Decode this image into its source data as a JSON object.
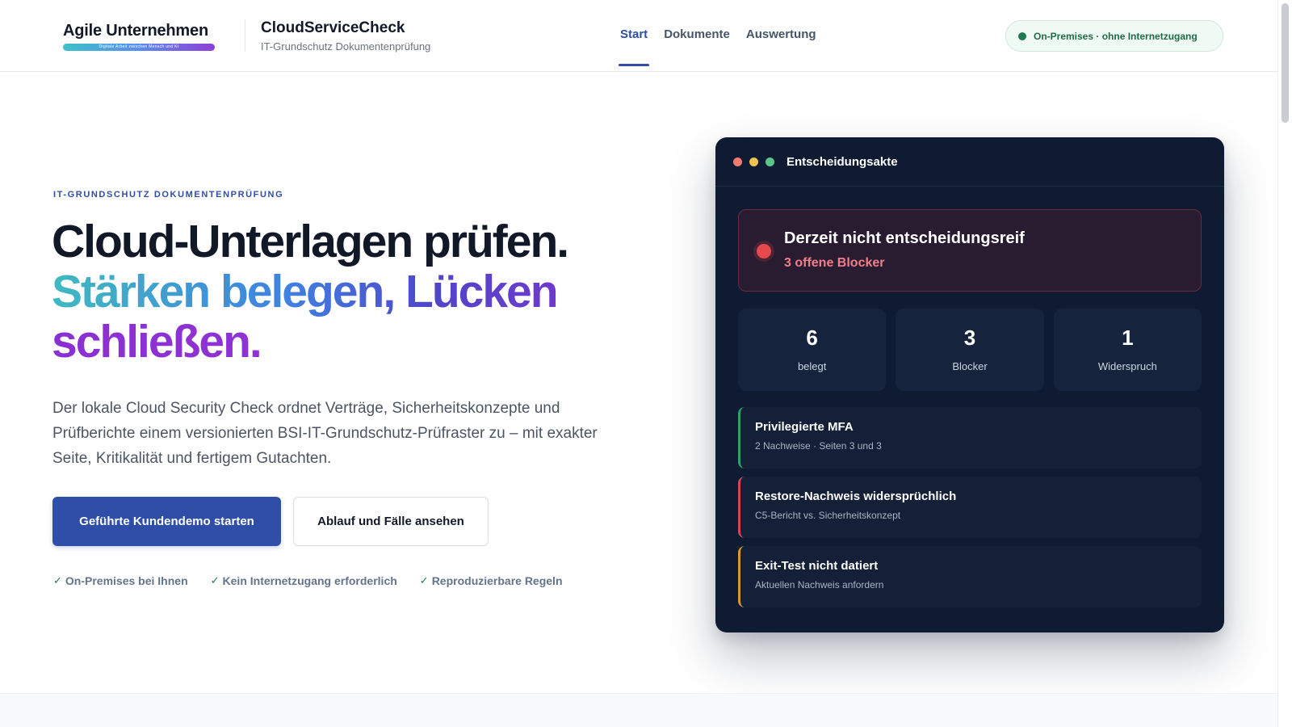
{
  "header": {
    "logo_text": "Agile Unternehmen",
    "logo_tagline": "Digitale Arbeit zwischen Mensch und KI",
    "brand_title": "CloudServiceCheck",
    "brand_subtitle": "IT-Grundschutz Dokumentenprüfung",
    "nav": [
      {
        "label": "Start",
        "active": true
      },
      {
        "label": "Dokumente",
        "active": false
      },
      {
        "label": "Auswertung",
        "active": false
      }
    ],
    "status_label": "On-Premises · ohne Internetzugang"
  },
  "hero": {
    "eyebrow": "IT-GRUNDSCHUTZ DOKUMENTENPRÜFUNG",
    "headline_line1": "Cloud-Unterlagen prüfen.",
    "headline_line2": "Stärken belegen, Lücken",
    "headline_line3": "schließen.",
    "lead": "Der lokale Cloud Security Check ordnet Verträge, Sicherheitskonzepte und Prüfberichte einem versionierten BSI-IT-Grundschutz-Prüfraster zu – mit exakter Seite, Kritikalität und fertigem Gutachten.",
    "primary_button": "Geführte Kundendemo starten",
    "secondary_button": "Ablauf und Fälle ansehen",
    "checks": [
      "On-Premises bei Ihnen",
      "Kein Internetzugang erforderlich",
      "Reproduzierbare Regeln"
    ]
  },
  "panel": {
    "title": "Entscheidungsakte",
    "alert_title": "Derzeit nicht entscheidungsreif",
    "alert_subtitle": "3 offene Blocker",
    "stats": [
      {
        "value": "6",
        "label": "belegt"
      },
      {
        "value": "3",
        "label": "Blocker"
      },
      {
        "value": "1",
        "label": "Widerspruch"
      }
    ],
    "items": [
      {
        "title": "Privilegierte MFA",
        "subtitle": "2 Nachweise · Seiten 3 und 3",
        "status": "green"
      },
      {
        "title": "Restore-Nachweis widersprüchlich",
        "subtitle": "C5-Bericht vs. Sicherheitskonzept",
        "status": "red"
      },
      {
        "title": "Exit-Test nicht datiert",
        "subtitle": "Aktuellen Nachweis anfordern",
        "status": "amber"
      }
    ]
  },
  "colors": {
    "accent": "#2f4ea8",
    "panel_bg": "#0f1b33",
    "success": "#1f7a4d",
    "danger": "#e5484d",
    "warning": "#d99a2b"
  },
  "icons": {
    "check": "check-icon",
    "status_dot": "status-dot-icon"
  }
}
